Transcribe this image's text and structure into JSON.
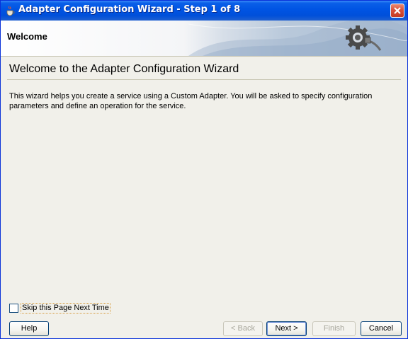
{
  "window": {
    "title": "Adapter Configuration Wizard - Step 1 of 8"
  },
  "banner": {
    "title": "Welcome"
  },
  "page": {
    "heading": "Welcome to the Adapter Configuration Wizard",
    "description": "This wizard helps you create a service using a Custom Adapter. You will be asked to specify configuration parameters and define an operation for the service."
  },
  "skip": {
    "label": "Skip this Page Next Time",
    "checked": false
  },
  "buttons": {
    "help": "Help",
    "back": "< Back",
    "next": "Next >",
    "finish": "Finish",
    "cancel": "Cancel"
  },
  "icons": {
    "app": "java-cup-icon",
    "close": "close-icon",
    "banner": "gear-plug-icon"
  }
}
